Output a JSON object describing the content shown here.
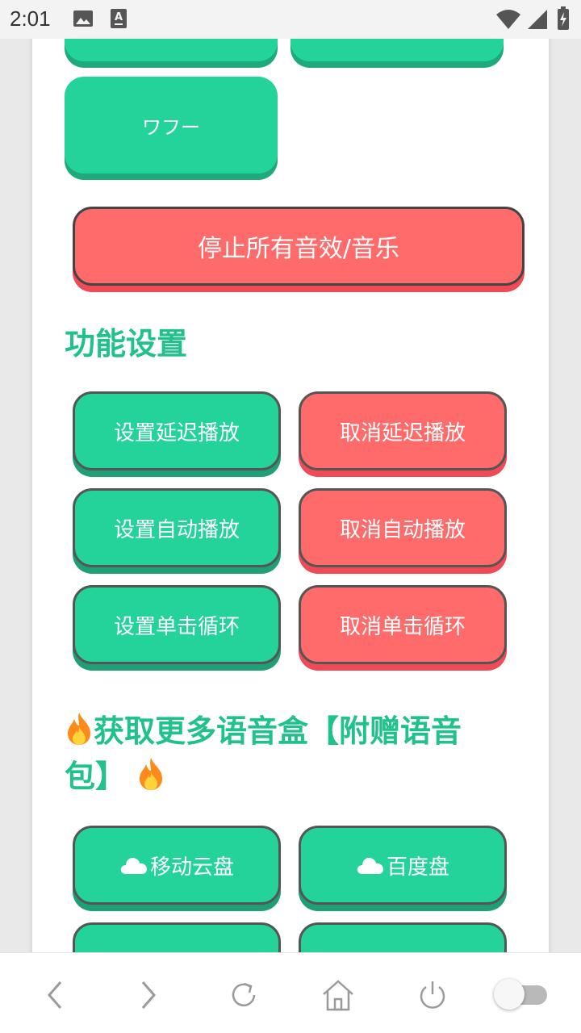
{
  "status_bar": {
    "time": "2:01",
    "icons": [
      "image-icon",
      "a-icon",
      "wifi-icon",
      "signal-icon",
      "battery-icon"
    ]
  },
  "sounds": {
    "partial_left_label": "",
    "partial_right_label": "",
    "wafu_label": "ワフー"
  },
  "stop_all_label": "停止所有音效/音乐",
  "settings": {
    "title": "功能设置",
    "set_delay": "设置延迟播放",
    "cancel_delay": "取消延迟播放",
    "set_auto": "设置自动播放",
    "cancel_auto": "取消自动播放",
    "set_loop": "设置单击循环",
    "cancel_loop": "取消单击循环"
  },
  "more": {
    "title_line1": "获取更多语音盒【附赠语音",
    "title_line2": "包】",
    "mobile_cloud": "移动云盘",
    "baidu": "百度盘"
  },
  "bottom_nav": {
    "items": [
      "back-icon",
      "forward-icon",
      "refresh-icon",
      "home-icon",
      "power-icon",
      "toggle-switch"
    ],
    "toggle_on": false
  },
  "colors": {
    "green": "#23d39a",
    "red": "#ff6b6b",
    "title_green": "#21c18c"
  }
}
